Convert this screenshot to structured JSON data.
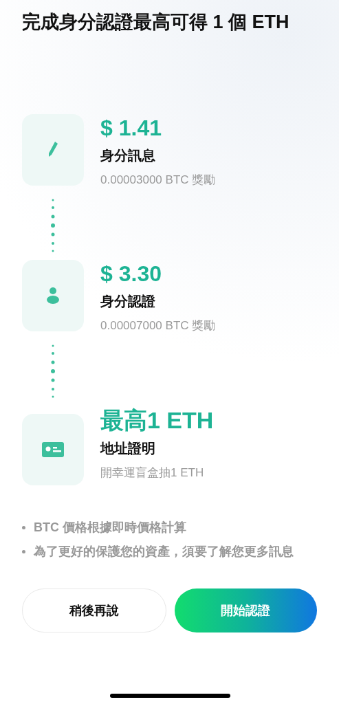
{
  "title": "完成身分認證最高可得 1 個 ETH",
  "steps": [
    {
      "kind": "pencil",
      "reward": "$ 1.41",
      "name": "身分訊息",
      "detail": "0.00003000 BTC 獎勵"
    },
    {
      "kind": "person",
      "reward": "$ 3.30",
      "name": "身分認證",
      "detail": "0.00007000 BTC 獎勵"
    },
    {
      "kind": "card",
      "reward": "最高1 ETH",
      "name": "地址證明",
      "detail": "開幸運盲盒抽1 ETH"
    }
  ],
  "notes": [
    "BTC 價格根據即時價格計算",
    "為了更好的保護您的資產，須要了解您更多訊息"
  ],
  "buttons": {
    "later": "稍後再說",
    "start": "開始認證"
  }
}
